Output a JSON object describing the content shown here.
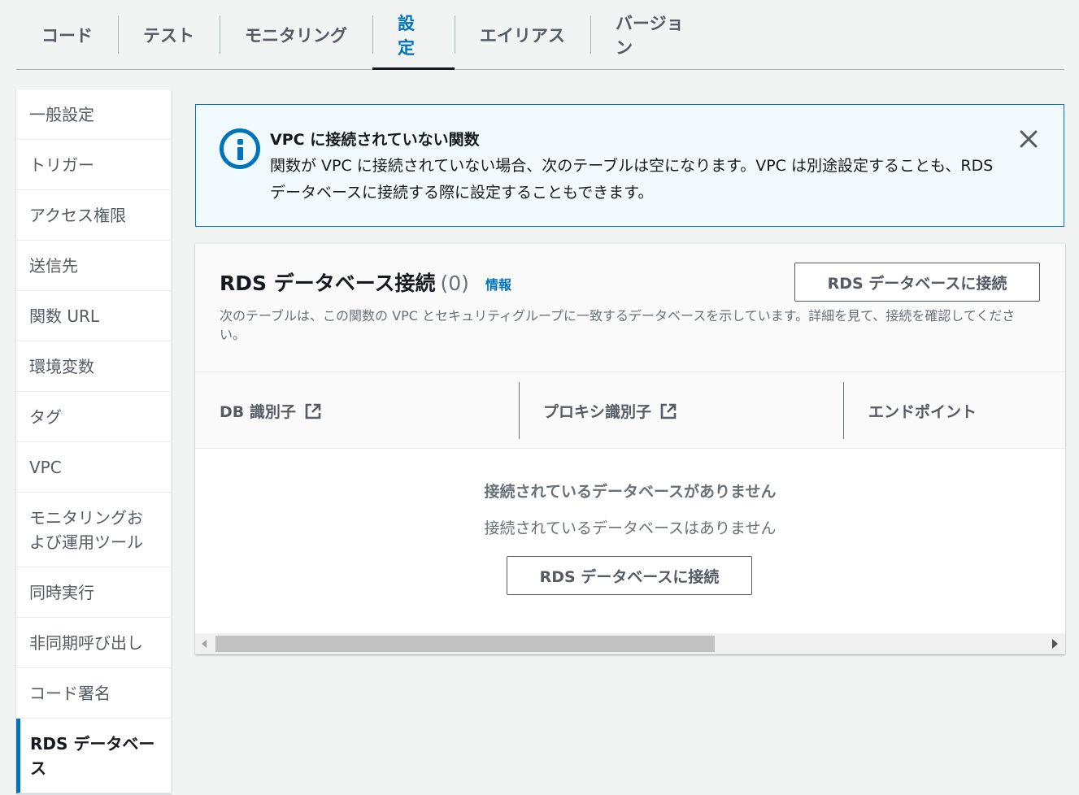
{
  "tabs": [
    {
      "label": "コード"
    },
    {
      "label": "テスト"
    },
    {
      "label": "モニタリング"
    },
    {
      "label": "設定"
    },
    {
      "label": "エイリアス"
    },
    {
      "label": "バージョン"
    }
  ],
  "active_tab": "設定",
  "sidenav": {
    "items": [
      {
        "label": "一般設定"
      },
      {
        "label": "トリガー"
      },
      {
        "label": "アクセス権限"
      },
      {
        "label": "送信先"
      },
      {
        "label": "関数 URL"
      },
      {
        "label": "環境変数"
      },
      {
        "label": "タグ"
      },
      {
        "label": "VPC"
      },
      {
        "label": "モニタリングおよび運用ツール"
      },
      {
        "label": "同時実行"
      },
      {
        "label": "非同期呼び出し"
      },
      {
        "label": "コード署名"
      },
      {
        "label": "RDS データベース"
      }
    ],
    "active": "RDS データベース"
  },
  "flash": {
    "type": "info",
    "title": "VPC に接続されていない関数",
    "message": "関数が VPC に接続されていない場合、次のテーブルは空になります。VPC は別途設定することも、RDS データベースに接続する際に設定することもできます。",
    "icon": "info-circle-icon"
  },
  "rds": {
    "title": "RDS データベース接続",
    "count": "(0)",
    "info_link": "情報",
    "connect_button": "RDS データベースに接続",
    "description": "次のテーブルは、この関数の VPC とセキュリティグループに一致するデータベースを示しています。詳細を見て、接続を確認してください。",
    "columns": [
      {
        "label": "DB 識別子",
        "external_link": true
      },
      {
        "label": "プロキシ識別子",
        "external_link": true
      },
      {
        "label": "エンドポイント",
        "external_link": false
      }
    ],
    "empty_title": "接続されているデータベースがありません",
    "empty_description": "接続されているデータベースはありません",
    "empty_button": "RDS データベースに接続"
  },
  "colors": {
    "accent": "#0073bb",
    "flash_bg": "#f1faff",
    "text": "#16191f",
    "muted": "#687078"
  }
}
